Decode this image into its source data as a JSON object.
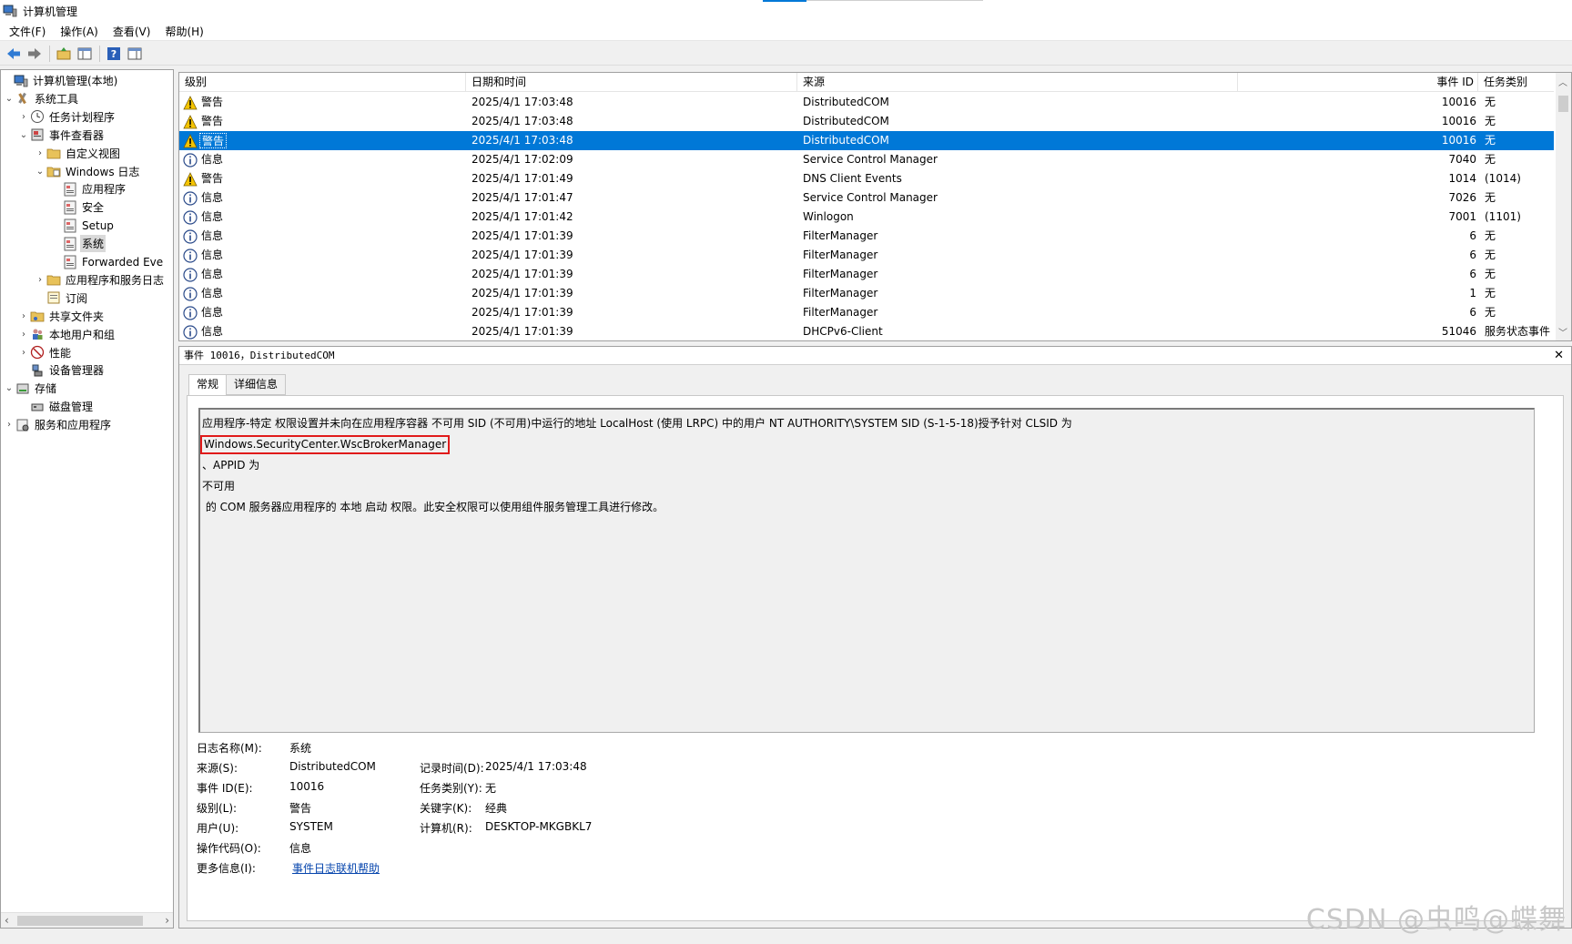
{
  "window": {
    "title": "计算机管理"
  },
  "menu": {
    "items": [
      "文件(F)",
      "操作(A)",
      "查看(V)",
      "帮助(H)"
    ]
  },
  "tree": {
    "nodes": [
      {
        "label": "计算机管理(本地)",
        "icon": "computer-management-icon",
        "expander": ""
      },
      {
        "label": "系统工具",
        "icon": "tools-icon",
        "expander": "⌄"
      },
      {
        "label": "任务计划程序",
        "icon": "clock-icon",
        "expander": "›"
      },
      {
        "label": "事件查看器",
        "icon": "event-viewer-icon",
        "expander": "⌄"
      },
      {
        "label": "自定义视图",
        "icon": "folder-icon",
        "expander": "›"
      },
      {
        "label": "Windows 日志",
        "icon": "folder-log-icon",
        "expander": "⌄"
      },
      {
        "label": "应用程序",
        "icon": "log-icon",
        "expander": ""
      },
      {
        "label": "安全",
        "icon": "log-icon",
        "expander": ""
      },
      {
        "label": "Setup",
        "icon": "log-icon",
        "expander": ""
      },
      {
        "label": "系统",
        "icon": "log-icon",
        "expander": ""
      },
      {
        "label": "Forwarded Eve",
        "icon": "log-icon",
        "expander": ""
      },
      {
        "label": "应用程序和服务日志",
        "icon": "folder-icon",
        "expander": "›"
      },
      {
        "label": "订阅",
        "icon": "subscription-icon",
        "expander": ""
      },
      {
        "label": "共享文件夹",
        "icon": "shared-folder-icon",
        "expander": "›"
      },
      {
        "label": "本地用户和组",
        "icon": "users-icon",
        "expander": "›"
      },
      {
        "label": "性能",
        "icon": "performance-icon",
        "expander": "›"
      },
      {
        "label": "设备管理器",
        "icon": "device-manager-icon",
        "expander": ""
      },
      {
        "label": "存储",
        "icon": "storage-icon",
        "expander": "⌄"
      },
      {
        "label": "磁盘管理",
        "icon": "disk-icon",
        "expander": ""
      },
      {
        "label": "服务和应用程序",
        "icon": "services-icon",
        "expander": "›"
      }
    ],
    "selected": "系统"
  },
  "events": {
    "columns": [
      "级别",
      "日期和时间",
      "来源",
      "事件 ID",
      "任务类别"
    ],
    "rows": [
      {
        "level": "警告",
        "icon": "warning-icon",
        "datetime": "2025/4/1 17:03:48",
        "source": "DistributedCOM",
        "event_id": "10016",
        "category": "无"
      },
      {
        "level": "警告",
        "icon": "warning-icon",
        "datetime": "2025/4/1 17:03:48",
        "source": "DistributedCOM",
        "event_id": "10016",
        "category": "无"
      },
      {
        "level": "警告",
        "icon": "warning-icon",
        "datetime": "2025/4/1 17:03:48",
        "source": "DistributedCOM",
        "event_id": "10016",
        "category": "无"
      },
      {
        "level": "信息",
        "icon": "info-icon",
        "datetime": "2025/4/1 17:02:09",
        "source": "Service Control Manager",
        "event_id": "7040",
        "category": "无"
      },
      {
        "level": "警告",
        "icon": "warning-icon",
        "datetime": "2025/4/1 17:01:49",
        "source": "DNS Client Events",
        "event_id": "1014",
        "category": "(1014)"
      },
      {
        "level": "信息",
        "icon": "info-icon",
        "datetime": "2025/4/1 17:01:47",
        "source": "Service Control Manager",
        "event_id": "7026",
        "category": "无"
      },
      {
        "level": "信息",
        "icon": "info-icon",
        "datetime": "2025/4/1 17:01:42",
        "source": "Winlogon",
        "event_id": "7001",
        "category": "(1101)"
      },
      {
        "level": "信息",
        "icon": "info-icon",
        "datetime": "2025/4/1 17:01:39",
        "source": "FilterManager",
        "event_id": "6",
        "category": "无"
      },
      {
        "level": "信息",
        "icon": "info-icon",
        "datetime": "2025/4/1 17:01:39",
        "source": "FilterManager",
        "event_id": "6",
        "category": "无"
      },
      {
        "level": "信息",
        "icon": "info-icon",
        "datetime": "2025/4/1 17:01:39",
        "source": "FilterManager",
        "event_id": "6",
        "category": "无"
      },
      {
        "level": "信息",
        "icon": "info-icon",
        "datetime": "2025/4/1 17:01:39",
        "source": "FilterManager",
        "event_id": "1",
        "category": "无"
      },
      {
        "level": "信息",
        "icon": "info-icon",
        "datetime": "2025/4/1 17:01:39",
        "source": "FilterManager",
        "event_id": "6",
        "category": "无"
      },
      {
        "level": "信息",
        "icon": "info-icon",
        "datetime": "2025/4/1 17:01:39",
        "source": "DHCPv6-Client",
        "event_id": "51046",
        "category": "服务状态事件"
      }
    ],
    "selected_index": 2
  },
  "detail": {
    "header": "事件 10016，DistributedCOM",
    "tabs": [
      "常规",
      "详细信息"
    ],
    "description": {
      "line1": "应用程序-特定 权限设置并未向在应用程序容器 不可用 SID (不可用)中运行的地址 LocalHost (使用 LRPC) 中的用户 NT AUTHORITY\\SYSTEM SID (S-1-5-18)授予针对 CLSID 为",
      "line2": "Windows.SecurityCenter.WscBrokerManager",
      "line3": "、APPID 为",
      "line4": "不可用",
      "line5": " 的 COM 服务器应用程序的 本地 启动 权限。此安全权限可以使用组件服务管理工具进行修改。"
    },
    "props": {
      "log_name_label": "日志名称(M):",
      "log_name": "系统",
      "source_label": "来源(S):",
      "source": "DistributedCOM",
      "logged_label": "记录时间(D):",
      "logged": "2025/4/1 17:03:48",
      "event_id_label": "事件 ID(E):",
      "event_id": "10016",
      "task_label": "任务类别(Y):",
      "task": "无",
      "level_label": "级别(L):",
      "level": "警告",
      "keywords_label": "关键字(K):",
      "keywords": "经典",
      "user_label": "用户(U):",
      "user": "SYSTEM",
      "computer_label": "计算机(R):",
      "computer": "DESKTOP-MKGBKL7",
      "opcode_label": "操作代码(O):",
      "opcode": "信息",
      "more_label": "更多信息(I):",
      "more_link": "事件日志联机帮助"
    }
  },
  "watermark": "CSDN @虫鸣@蝶舞",
  "colors": {
    "selection": "#0078d7",
    "highlight_box": "#e01a1a",
    "link": "#0645ad"
  }
}
